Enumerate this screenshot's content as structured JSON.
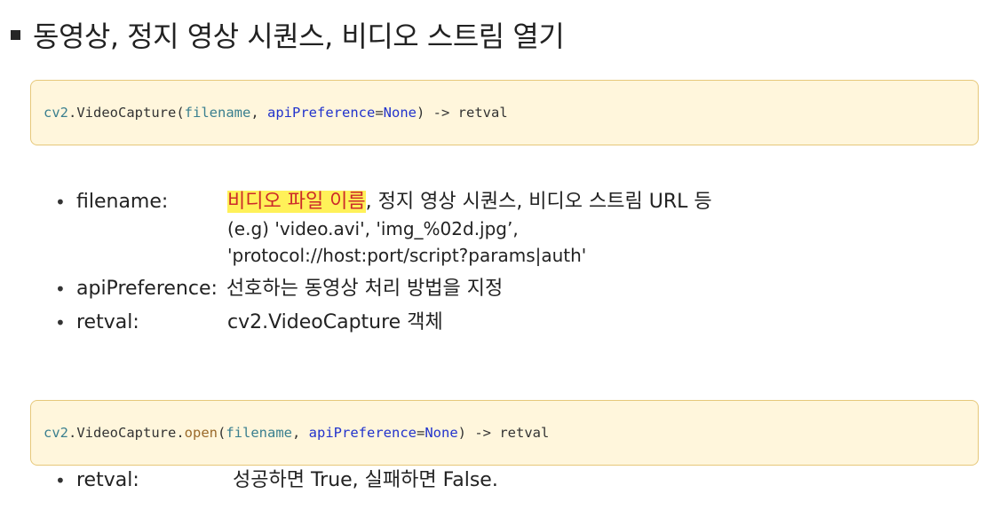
{
  "title": "동영상, 정지 영상 시퀀스, 비디오 스트림 열기",
  "code1": {
    "module": "cv2",
    "dot": ".",
    "func": "VideoCapture",
    "open_paren": "(",
    "arg1": "filename",
    "sep": ", ",
    "arg2": "apiPreference",
    "eq": "=",
    "default": "None",
    "close_paren": ")",
    "ret": " -> retval"
  },
  "params1": {
    "filename": {
      "name": "filename:",
      "highlight": "비디오 파일 이름",
      "rest": ", 정지 영상 시퀀스, 비디오 스트림 URL 등",
      "example_line1": "(e.g) 'video.avi', 'img_%02d.jpg’,",
      "example_line2": "'protocol://host:port/script?params|auth'"
    },
    "apiPreference": {
      "name": "apiPreference:",
      "desc": "선호하는 동영상 처리 방법을 지정"
    },
    "retval": {
      "name": "retval:",
      "desc": "cv2.VideoCapture 객체"
    }
  },
  "code2": {
    "module": "cv2",
    "dot1": ".",
    "cls": "VideoCapture",
    "dot2": ".",
    "method": "open",
    "open_paren": "(",
    "arg1": "filename",
    "sep": ", ",
    "arg2": "apiPreference",
    "eq": "=",
    "default": "None",
    "close_paren": ")",
    "ret": " -> retval"
  },
  "params2": {
    "retval": {
      "name": "retval:",
      "desc": "성공하면 True, 실패하면 False."
    }
  },
  "bullet_char": "•",
  "colors": {
    "code_bg": "#fff6dc",
    "code_border": "#e6c87a",
    "highlight_bg": "#fff159",
    "highlight_text": "#cc2a2a",
    "keyword": "#2233cc",
    "identifier": "#3a7f8f",
    "method": "#9a6a2a"
  }
}
